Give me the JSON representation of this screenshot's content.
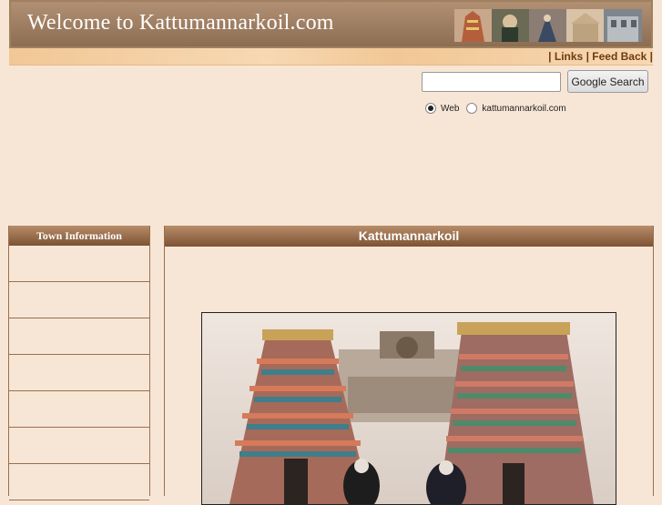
{
  "header": {
    "title": "Welcome to Kattumannarkoil.com",
    "photos": [
      "gopuram-photo",
      "deity-photo",
      "procession-photo",
      "temple-photo",
      "building-photo"
    ]
  },
  "top_links": {
    "sep1": "|",
    "links_label": "Links",
    "sep2": "|",
    "feedback_label": "Feed Back",
    "sep3": "|"
  },
  "search": {
    "input_value": "",
    "button_label": "Google Search",
    "options": [
      {
        "label": "Web",
        "checked": true
      },
      {
        "label": "kattumannarkoil.com",
        "checked": false
      }
    ]
  },
  "sidebar": {
    "title": "Town Information",
    "items": [
      "",
      "",
      "",
      "",
      "",
      "",
      ""
    ]
  },
  "main": {
    "title": "Kattumannarkoil",
    "image": "temple-gopurams-photo"
  },
  "colors": {
    "background": "#f7e6d6",
    "banner": "#8e6e52",
    "header_bar": "#7c5233",
    "link": "#6e3a12"
  }
}
